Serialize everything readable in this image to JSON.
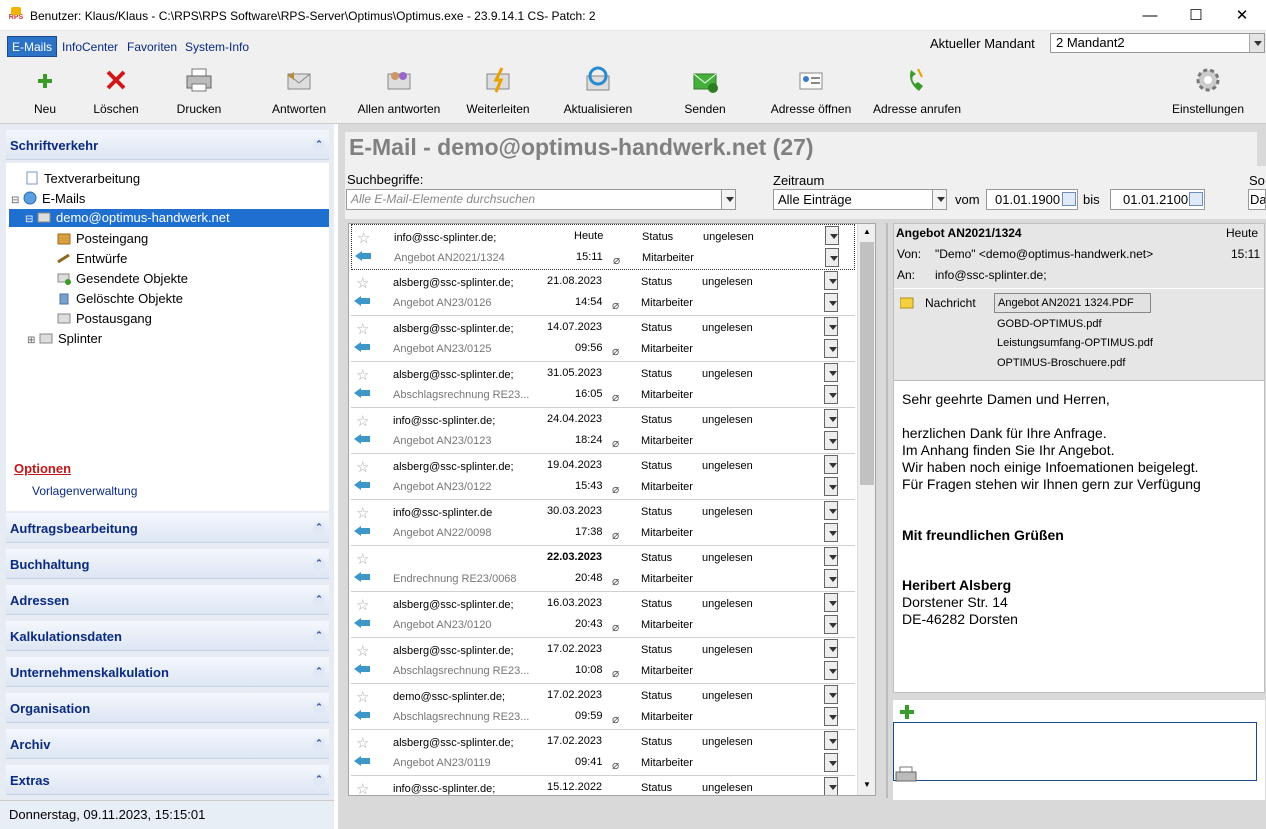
{
  "window": {
    "title": "Benutzer: Klaus/Klaus - C:\\RPS\\RPS Software\\RPS-Server\\Optimus\\Optimus.exe - 23.9.14.1 CS- Patch: 2",
    "app_icon_text": "RPS",
    "minimize": "—",
    "maximize": "☐",
    "close": "✕"
  },
  "menu": {
    "items": [
      "E-Mails",
      "InfoCenter",
      "Favoriten",
      "System-Info"
    ]
  },
  "mandant": {
    "label": "Aktueller Mandant",
    "value": "2 Mandant2"
  },
  "toolbar": {
    "buttons": [
      {
        "label": "Neu",
        "icon": "plus-icon"
      },
      {
        "label": "Löschen",
        "icon": "delete-icon"
      },
      {
        "label": "Drucken",
        "icon": "printer-icon"
      },
      {
        "label": "Antworten",
        "icon": "reply-icon"
      },
      {
        "label": "Allen antworten",
        "icon": "reply-all-icon"
      },
      {
        "label": "Weiterleiten",
        "icon": "forward-icon"
      },
      {
        "label": "Aktualisieren",
        "icon": "refresh-icon"
      },
      {
        "label": "Senden",
        "icon": "send-icon"
      },
      {
        "label": "Adresse öffnen",
        "icon": "address-card-icon"
      },
      {
        "label": "Adresse anrufen",
        "icon": "phone-icon"
      },
      {
        "label": "Einstellungen",
        "icon": "gear-icon"
      }
    ]
  },
  "sidebar": {
    "top_section": "Schriftverkehr",
    "tree": [
      {
        "label": "Textverarbeitung"
      },
      {
        "label": "E-Mails",
        "toggle": "⊟"
      },
      {
        "label": "demo@optimus-handwerk.net",
        "toggle": "⊟"
      },
      {
        "label": "Posteingang"
      },
      {
        "label": "Entwürfe"
      },
      {
        "label": "Gesendete Objekte"
      },
      {
        "label": "Gelöschte Objekte"
      },
      {
        "label": "Postausgang"
      },
      {
        "label": "Splinter",
        "toggle": "⊞"
      }
    ],
    "options_title": "Optionen",
    "options_item": "Vorlagenverwaltung",
    "sections": [
      "Auftragsbearbeitung",
      "Buchhaltung",
      "Adressen",
      "Kalkulationsdaten",
      "Unternehmenskalkulation",
      "Organisation",
      "Archiv",
      "Extras"
    ],
    "chevron": "⌃",
    "status": "Donnerstag, 09.11.2023, 15:15:01"
  },
  "main": {
    "title": "E-Mail - demo@optimus-handwerk.net (27)",
    "search_label": "Suchbegriffe:",
    "search_placeholder": "Alle E-Mail-Elemente durchsuchen",
    "zeitraum_label": "Zeitraum",
    "zeitraum_value": "Alle Einträge",
    "vom_label": "vom",
    "vom_value": "01.01.1900",
    "bis_label": "bis",
    "bis_value": "01.01.2100",
    "so_label": "So",
    "so_value": "Da"
  },
  "emails": [
    {
      "from": "info@ssc-splinter.de;",
      "subject": "Angebot AN2021/1324",
      "date": "Heute",
      "time": "15:11",
      "status": "Status",
      "status_value": "ungelesen",
      "assignee": "Mitarbeiter"
    },
    {
      "from": "alsberg@ssc-splinter.de;",
      "subject": "Angebot AN23/0126",
      "date": "21.08.2023",
      "time": "14:54",
      "status": "Status",
      "status_value": "ungelesen",
      "assignee": "Mitarbeiter"
    },
    {
      "from": "alsberg@ssc-splinter.de;",
      "subject": "Angebot AN23/0125",
      "date": "14.07.2023",
      "time": "09:56",
      "status": "Status",
      "status_value": "ungelesen",
      "assignee": "Mitarbeiter"
    },
    {
      "from": "alsberg@ssc-splinter.de;",
      "subject": "Abschlagsrechnung RE23...",
      "date": "31.05.2023",
      "time": "16:05",
      "status": "Status",
      "status_value": "ungelesen",
      "assignee": "Mitarbeiter"
    },
    {
      "from": "info@ssc-splinter.de;",
      "subject": "Angebot AN23/0123",
      "date": "24.04.2023",
      "time": "18:24",
      "status": "Status",
      "status_value": "ungelesen",
      "assignee": "Mitarbeiter"
    },
    {
      "from": "alsberg@ssc-splinter.de;",
      "subject": "Angebot AN23/0122",
      "date": "19.04.2023",
      "time": "15:43",
      "status": "Status",
      "status_value": "ungelesen",
      "assignee": "Mitarbeiter"
    },
    {
      "from": "info@ssc-splinter.de",
      "subject": "Angebot AN22/0098",
      "date": "30.03.2023",
      "time": "17:38",
      "status": "Status",
      "status_value": "ungelesen",
      "assignee": "Mitarbeiter"
    },
    {
      "from": "",
      "subject": "Endrechnung RE23/0068",
      "date": "22.03.2023",
      "time": "20:48",
      "status": "Status",
      "status_value": "ungelesen",
      "assignee": "Mitarbeiter",
      "bold": true
    },
    {
      "from": "alsberg@ssc-splinter.de;",
      "subject": "Angebot AN23/0120",
      "date": "16.03.2023",
      "time": "20:43",
      "status": "Status",
      "status_value": "ungelesen",
      "assignee": "Mitarbeiter"
    },
    {
      "from": "alsberg@ssc-splinter.de;",
      "subject": "Abschlagsrechnung RE23...",
      "date": "17.02.2023",
      "time": "10:08",
      "status": "Status",
      "status_value": "ungelesen",
      "assignee": "Mitarbeiter"
    },
    {
      "from": "demo@ssc-splinter.de;",
      "subject": "Abschlagsrechnung RE23...",
      "date": "17.02.2023",
      "time": "09:59",
      "status": "Status",
      "status_value": "ungelesen",
      "assignee": "Mitarbeiter"
    },
    {
      "from": "alsberg@ssc-splinter.de;",
      "subject": "Angebot AN23/0119",
      "date": "17.02.2023",
      "time": "09:41",
      "status": "Status",
      "status_value": "ungelesen",
      "assignee": "Mitarbeiter"
    },
    {
      "from": "info@ssc-splinter.de;",
      "subject": "",
      "date": "15.12.2022",
      "time": "",
      "status": "Status",
      "status_value": "ungelesen",
      "assignee": ""
    }
  ],
  "preview": {
    "subject": "Angebot AN2021/1324",
    "date": "Heute",
    "time": "15:11",
    "from_label": "Von:",
    "from": "\"Demo\" <demo@optimus-handwerk.net>",
    "to_label": "An:",
    "to": "info@ssc-splinter.de;",
    "message_label": "Nachricht",
    "attachments": [
      "Angebot AN2021 1324.PDF",
      "GOBD-OPTIMUS.pdf",
      "Leistungsumfang-OPTIMUS.pdf",
      "OPTIMUS-Broschuere.pdf"
    ],
    "body": {
      "greeting": "Sehr geehrte Damen und Herren,",
      "lines": [
        "herzlichen Dank für Ihre Anfrage.",
        "Im Anhang finden Sie Ihr Angebot.",
        "Wir haben noch einige Infoemationen beigelegt.",
        "Für Fragen stehen wir Ihnen gern zur Verfügung"
      ],
      "closing": "Mit freundlichen Grüßen",
      "sig_name": "Heribert Alsberg",
      "sig_street": "Dorstener Str. 14",
      "sig_city": "DE-46282 Dorsten"
    }
  }
}
